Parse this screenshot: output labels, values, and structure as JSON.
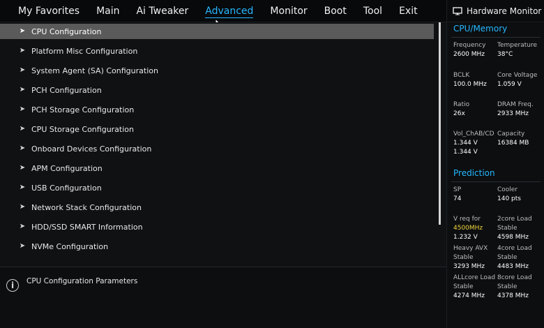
{
  "tabs": [
    {
      "label": "My Favorites",
      "active": false
    },
    {
      "label": "Main",
      "active": false
    },
    {
      "label": "Ai Tweaker",
      "active": false
    },
    {
      "label": "Advanced",
      "active": true
    },
    {
      "label": "Monitor",
      "active": false
    },
    {
      "label": "Boot",
      "active": false
    },
    {
      "label": "Tool",
      "active": false
    },
    {
      "label": "Exit",
      "active": false
    }
  ],
  "menu": {
    "selected_index": 0,
    "items": [
      "CPU Configuration",
      "Platform Misc Configuration",
      "System Agent (SA) Configuration",
      "PCH Configuration",
      "PCH Storage Configuration",
      "CPU Storage Configuration",
      "Onboard Devices Configuration",
      "APM Configuration",
      "USB Configuration",
      "Network Stack Configuration",
      "HDD/SSD SMART Information",
      "NVMe Configuration"
    ]
  },
  "help": {
    "text": "CPU Configuration Parameters"
  },
  "hardware_monitor": {
    "title": "Hardware Monitor",
    "cpu_memory": {
      "title": "CPU/Memory",
      "frequency": {
        "label": "Frequency",
        "value": "2600 MHz"
      },
      "temperature": {
        "label": "Temperature",
        "value": "38°C"
      },
      "bclk": {
        "label": "BCLK",
        "value": "100.0 MHz"
      },
      "core_voltage": {
        "label": "Core Voltage",
        "value": "1.059 V"
      },
      "ratio": {
        "label": "Ratio",
        "value": "26x"
      },
      "dram_freq": {
        "label": "DRAM Freq.",
        "value": "2933 MHz"
      },
      "vol_chab_cd": {
        "label": "Vol_ChAB/CD",
        "value1": "1.344 V",
        "value2": "1.344 V"
      },
      "capacity": {
        "label": "Capacity",
        "value": "16384 MB"
      }
    },
    "prediction": {
      "title": "Prediction",
      "sp": {
        "label": "SP",
        "value": "74"
      },
      "cooler": {
        "label": "Cooler",
        "value": "140 pts"
      },
      "vreq": {
        "label": "V req for",
        "freq": "4500MHz",
        "value": "1.232 V"
      },
      "two_core": {
        "label": "2core Load",
        "label2": "Stable",
        "value": "4598 MHz"
      },
      "heavy_avx": {
        "label": "Heavy AVX",
        "label2": "Stable",
        "value": "3293 MHz"
      },
      "four_core": {
        "label": "4core Load",
        "label2": "Stable",
        "value": "4483 MHz"
      },
      "allcore": {
        "label": "ALLcore Load",
        "label2": "Stable",
        "value": "4274 MHz"
      },
      "eight_core": {
        "label": "8core Load",
        "label2": "Stable",
        "value": "4378 MHz"
      }
    }
  },
  "colors": {
    "accent": "#26b8ff",
    "highlight": "#f2d43d",
    "selected_row": "#5a5a5a"
  }
}
